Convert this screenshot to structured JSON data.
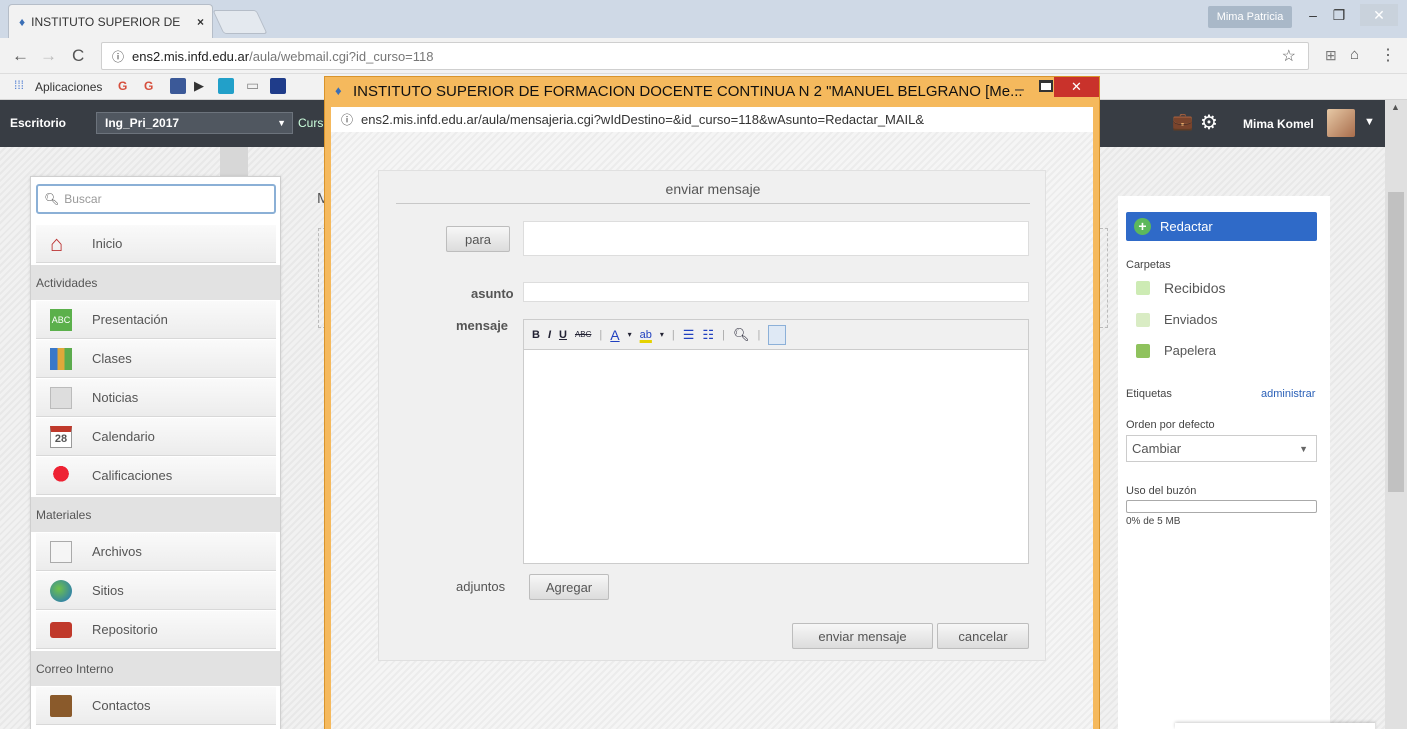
{
  "browser": {
    "tab_title": "INSTITUTO SUPERIOR DE",
    "tab_close": "×",
    "profile_name": "Mima Patricia",
    "url_domain": "ens2.mis.infd.edu.ar",
    "url_path": "/aula/webmail.cgi?id_curso=118",
    "apps_label": "Aplicaciones"
  },
  "site": {
    "desk_label": "Escritorio",
    "course_select": "Ing_Pri_2017",
    "course_tab_partial": "Curs",
    "user_name": "Mima Komel"
  },
  "sidebar": {
    "search_placeholder": "Buscar",
    "home": "Inicio",
    "section_activities": "Actividades",
    "activities": [
      "Presentación",
      "Clases",
      "Noticias",
      "Calendario",
      "Calificaciones"
    ],
    "section_materials": "Materiales",
    "materials": [
      "Archivos",
      "Sitios",
      "Repositorio"
    ],
    "section_mail": "Correo Interno",
    "mail": [
      "Contactos"
    ]
  },
  "mail_panel": {
    "compose": "Redactar",
    "folders_title": "Carpetas",
    "folders": [
      "Recibidos",
      "Enviados",
      "Papelera"
    ],
    "labels_title": "Etiquetas",
    "labels_manage": "administrar",
    "order_title": "Orden por defecto",
    "order_value": "Cambiar",
    "usage_title": "Uso del buzón",
    "usage_text": "0% de 5 MB",
    "usage_fraction": 0
  },
  "popup": {
    "title": "INSTITUTO SUPERIOR DE FORMACION DOCENTE CONTINUA N 2 \"MANUEL BELGRANO [Me...",
    "url": "ens2.mis.infd.edu.ar/aula/mensajeria.cgi?wIdDestino=&id_curso=118&wAsunto=Redactar_MAIL&",
    "form_title": "enviar mensaje",
    "to_button": "para",
    "subject_label": "asunto",
    "message_label": "mensaje",
    "attachments_label": "adjuntos",
    "add_button": "Agregar",
    "send_button": "enviar mensaje",
    "cancel_button": "cancelar",
    "editor_tools": [
      "B",
      "I",
      "U",
      "ABC",
      "A",
      "ab"
    ]
  }
}
